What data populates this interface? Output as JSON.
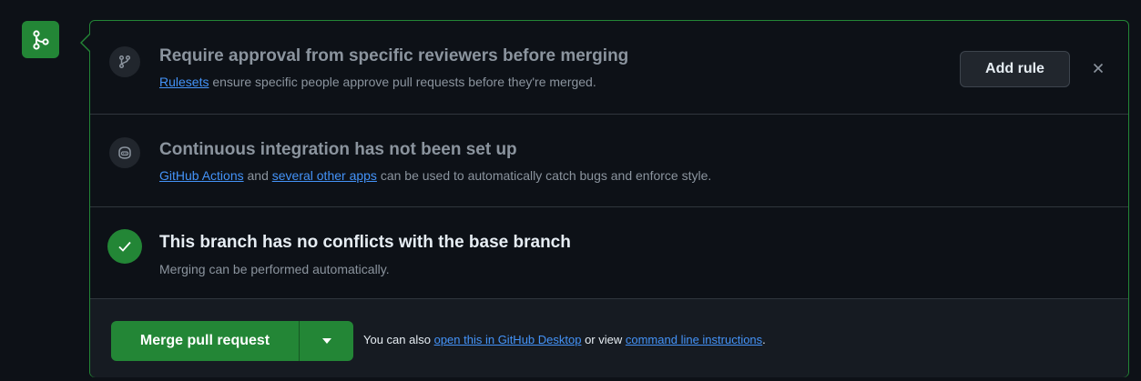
{
  "icons": {
    "merge": "git-merge-icon",
    "reviewers": "git-branch-icon",
    "ci": "copilot-icon",
    "conflicts": "check-icon",
    "close": "close-icon",
    "dropdown": "triangle-down-icon"
  },
  "colors": {
    "accent_green": "#238636",
    "link_blue": "#4493f8",
    "muted_text": "#8b949e",
    "background": "#0d1117",
    "border": "#30363d"
  },
  "reviewers_section": {
    "title": "Require approval from specific reviewers before merging",
    "link": "Rulesets",
    "desc_rest": " ensure specific people approve pull requests before they're merged.",
    "button": "Add rule"
  },
  "ci_section": {
    "title": "Continuous integration has not been set up",
    "link1": "GitHub Actions",
    "desc_mid": " and ",
    "link2": "several other apps",
    "desc_rest": " can be used to automatically catch bugs and enforce style."
  },
  "conflicts_section": {
    "title": "This branch has no conflicts with the base branch",
    "desc": "Merging can be performed automatically."
  },
  "merge_section": {
    "button": "Merge pull request",
    "prefix": "You can also ",
    "link1": "open this in GitHub Desktop",
    "mid": " or view ",
    "link2": "command line instructions",
    "suffix": "."
  }
}
